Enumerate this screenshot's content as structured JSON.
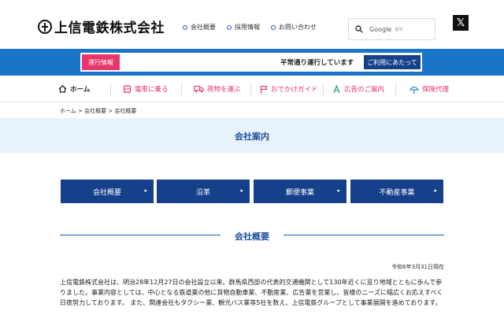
{
  "header": {
    "logo_text": "上信電鉄株式会社",
    "links": [
      "会社概要",
      "採用情報",
      "お問い合わせ"
    ],
    "search_label": "Google",
    "search_sub": "提供",
    "x_glyph": "𝕏"
  },
  "operation": {
    "label": "運行情報",
    "status": "平常通り運行しています",
    "button": "ご利用にあたって"
  },
  "nav": {
    "items": [
      {
        "label": "ホーム",
        "icon": "home-icon"
      },
      {
        "label": "電車に乗る",
        "icon": "train-icon"
      },
      {
        "label": "荷物を運ぶ",
        "icon": "truck-icon"
      },
      {
        "label": "おでかけガイド",
        "icon": "flag-icon"
      },
      {
        "label": "広告のご案内",
        "icon": "billboard-icon"
      },
      {
        "label": "保険代理",
        "icon": "umbrella-icon"
      }
    ]
  },
  "breadcrumb": "ホーム > 会社概要 > 会社概要",
  "page_title": "会社案内",
  "tabs": [
    "会社概要",
    "沿革",
    "郵便事業",
    "不動産事業"
  ],
  "section": {
    "title": "会社概要",
    "date": "令和6年3月31日現在",
    "body": "上信電鉄株式会社は、明治28年12月27日の会社設立以来、群馬県西部の代表的交通機関として130年近くに亘り地域とともに歩んで参りました。事業内容としては、中心となる鉄道業の他に貨物自動車業、不動産業、広告業を営業し、皆様のニーズに幅広くお応えすべく日夜努力しております。 また、関連会社もタクシー業、観光バス業等5社を数え、上信電鉄グループとして事業展開を進めております。"
  },
  "colors": {
    "brand_blue": "#1a74c7",
    "navy": "#16418a",
    "accent_pink": "#e8356b",
    "title_band": "#e8f2fb"
  }
}
